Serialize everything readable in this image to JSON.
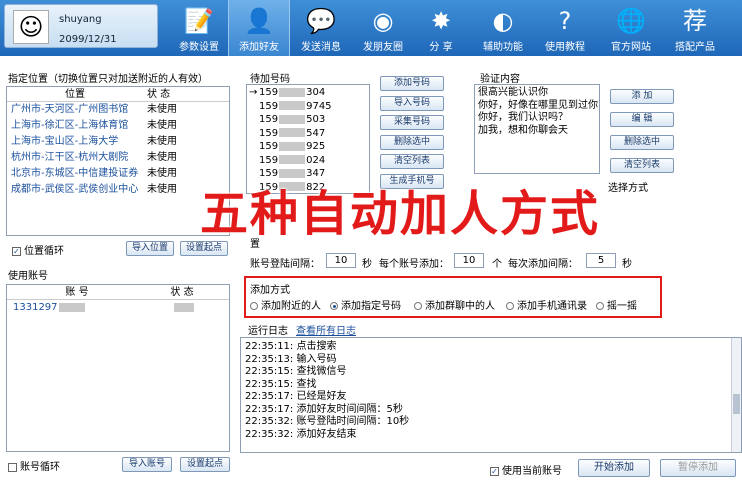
{
  "user": {
    "name": "shuyang",
    "date": "2099/12/31"
  },
  "nav": [
    {
      "label": "参数设置",
      "icon": "📝",
      "name": "settings"
    },
    {
      "label": "添加好友",
      "icon": "👤",
      "name": "add-friend"
    },
    {
      "label": "发送消息",
      "icon": "💬",
      "name": "send-message"
    },
    {
      "label": "发朋友圈",
      "icon": "◉",
      "name": "moments"
    },
    {
      "label": "分 享",
      "icon": "✸",
      "name": "share"
    },
    {
      "label": "辅助功能",
      "icon": "◐",
      "name": "tools"
    },
    {
      "label": "使用教程",
      "icon": "?",
      "name": "tutorial"
    },
    {
      "label": "官方网站",
      "icon": "🌐",
      "name": "website"
    },
    {
      "label": "搭配产品",
      "icon": "荐",
      "name": "products"
    }
  ],
  "location": {
    "title": "指定位置（切换位置只对加送附近的人有效）",
    "col_loc": "位置",
    "col_status": "状 态",
    "items": [
      {
        "loc": "广州市-天河区-广州图书馆",
        "status": "未使用"
      },
      {
        "loc": "上海市-徐汇区-上海体育馆",
        "status": "未使用"
      },
      {
        "loc": "上海市-宝山区-上海大学",
        "status": "未使用"
      },
      {
        "loc": "杭州市-江干区-杭州大剧院",
        "status": "未使用"
      },
      {
        "loc": "北京市-东城区-中信建投证券",
        "status": "未使用"
      },
      {
        "loc": "成都市-武侯区-武侯创业中心",
        "status": "未使用"
      }
    ],
    "loop_label": "位置循环",
    "import_label": "导入位置",
    "set_start_label": "设置起点"
  },
  "accounts": {
    "title": "使用账号",
    "col_account": "账 号",
    "col_status": "状 态",
    "first_account": "1331297",
    "loop_label": "账号循环",
    "import_label": "导入账号",
    "set_start_label": "设置起点"
  },
  "pending": {
    "title": "待加号码",
    "numbers": [
      {
        "prefix": "159",
        "suffix": "304"
      },
      {
        "prefix": "159",
        "suffix": "9745"
      },
      {
        "prefix": "159",
        "suffix": "503"
      },
      {
        "prefix": "159",
        "suffix": "547"
      },
      {
        "prefix": "159",
        "suffix": "925"
      },
      {
        "prefix": "159",
        "suffix": "024"
      },
      {
        "prefix": "159",
        "suffix": "347"
      },
      {
        "prefix": "159",
        "suffix": "822"
      }
    ],
    "buttons": [
      "添加号码",
      "导入号码",
      "采集号码",
      "删除选中",
      "清空列表",
      "生成手机号"
    ]
  },
  "verify": {
    "title": "验证内容",
    "lines": [
      "很高兴能认识你",
      "你好，好像在哪里见到过你",
      "你好，我们认识吗？",
      "加我，想和你聊会天"
    ],
    "buttons": [
      "添 加",
      "编 辑",
      "删除选中",
      "清空列表"
    ],
    "select_mode": "选择方式"
  },
  "overlay_text": "五种自动加人方式",
  "interval": {
    "partial_label": "置",
    "login_interval_label": "账号登陆间隔：",
    "login_interval": "10",
    "sec1": "秒",
    "per_account_label": "每个账号添加：",
    "per_account": "10",
    "unit": "个",
    "each_interval_label": "每次添加间隔：",
    "each_interval": "5",
    "sec2": "秒"
  },
  "mode": {
    "title": "添加方式",
    "options": [
      "添加附近的人",
      "添加指定号码",
      "添加群聊中的人",
      "添加手机通讯录",
      "摇一摇"
    ],
    "selected": 1
  },
  "log": {
    "title": "运行日志",
    "view_all": "查看所有日志",
    "lines": [
      "22:35:11:  点击搜索",
      "22:35:13:  输入号码",
      "22:35:15:  查找微信号",
      "22:35:15:  查找",
      "22:35:17:  已经是好友",
      "22:35:17:  添加好友时间间隔：5秒",
      "22:35:32:  账号登陆时间间隔：10秒",
      "22:35:32:  添加好友结束"
    ]
  },
  "footer": {
    "use_current_label": "使用当前账号",
    "start_label": "开始添加",
    "pause_label": "暂停添加"
  },
  "colors": {
    "nav_bg": "#1f67b8",
    "overlay_red": "#e31a1a",
    "highlight_red": "#e31a1a",
    "link_blue": "#1a4f9c"
  }
}
